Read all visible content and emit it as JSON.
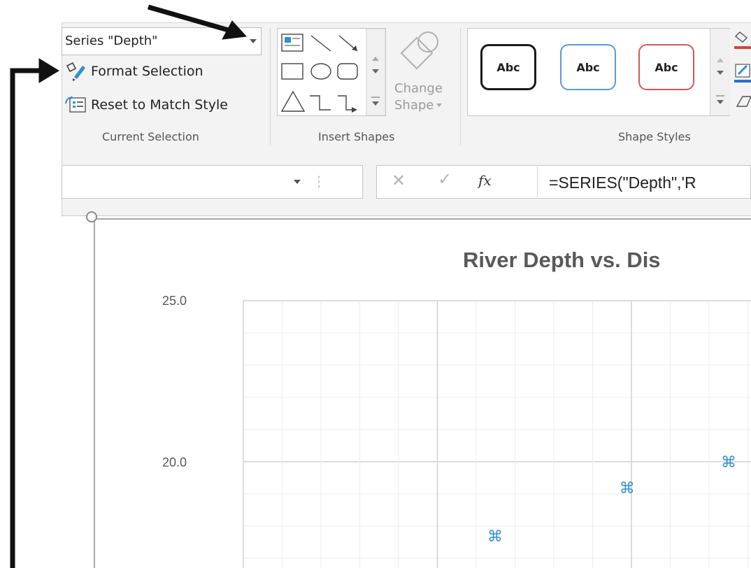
{
  "ribbon": {
    "current_selection": {
      "selected_element": "Series \"Depth\"",
      "format_selection_label": "Format Selection",
      "reset_label": "Reset to Match Style",
      "group_label": "Current Selection"
    },
    "insert_shapes": {
      "change_shape_label_line1": "Change",
      "change_shape_label_line2": "Shape",
      "group_label": "Insert Shapes"
    },
    "shape_styles": {
      "styles": [
        {
          "label": "Abc",
          "border_color": "#1a1a1a"
        },
        {
          "label": "Abc",
          "border_color": "#5b9bd5"
        },
        {
          "label": "Abc",
          "border_color": "#d05a5a"
        }
      ],
      "group_label": "Shape Styles"
    }
  },
  "formula_bar": {
    "name_box_value": "",
    "fx_label": "fx",
    "formula": "=SERIES(\"Depth\",'R"
  },
  "chart_data": {
    "type": "scatter",
    "title": "River Depth vs. Dis",
    "ytick_labels": [
      "25.0",
      "20.0"
    ],
    "ylim_visible": [
      17.3,
      25.0
    ],
    "series": [
      {
        "name": "Depth",
        "marker_color": "#2e8fd6",
        "marker_visible_positions": [
          {
            "x_fraction": 0.5,
            "y": 17.7
          },
          {
            "x_fraction": 0.76,
            "y": 19.2
          },
          {
            "x_fraction": 0.96,
            "y": 20.0
          }
        ]
      }
    ],
    "grid": true
  },
  "annotations": {
    "arrow_color": "#111111"
  }
}
